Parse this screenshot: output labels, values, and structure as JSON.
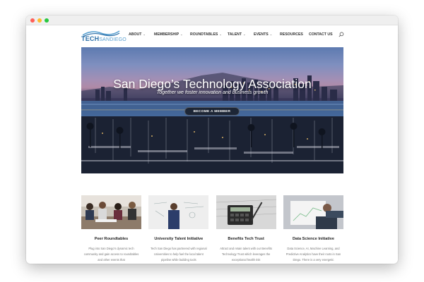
{
  "logo": {
    "bold": "TECH",
    "light": "SANDIEGO"
  },
  "nav": [
    {
      "label": "About",
      "dropdown": true,
      "width": 36
    },
    {
      "label": "Membership",
      "dropdown": true,
      "width": 51
    },
    {
      "label": "Roundtables",
      "dropdown": true,
      "width": 53
    },
    {
      "label": "Talent",
      "dropdown": true,
      "width": 37
    },
    {
      "label": "Events",
      "dropdown": true,
      "width": 37
    },
    {
      "label": "Resources",
      "dropdown": false,
      "width": 41
    },
    {
      "label": "Contact Us",
      "dropdown": false,
      "width": 40
    }
  ],
  "hero": {
    "title": "San Diego’s Technology Association",
    "subtitle": "Together we foster innovation and business growth",
    "button": "Become a Member"
  },
  "cards": [
    {
      "title": "Peer Roundtables",
      "text": "Plug into San Diego’s dynamic tech community and gain access to roundtables and other events that"
    },
    {
      "title": "University Talent Initiative",
      "text": "Tech San Diego has partnered with regional Universities to help fuel the local talent pipeline while building tools"
    },
    {
      "title": "Benefits Tech Trust",
      "text": "Attract and retain talent with our Benefits Technology Trust which leverages the exceptional health risk"
    },
    {
      "title": "Data Science Initiative",
      "text": "Data Science, AI, Machine Learning, and Predictive Analytics have their roots in San Diego. There is a very energetic"
    }
  ],
  "colors": {
    "accent": "#2a6fa8",
    "nav_text": "#333333",
    "button_bg": "#1d2636"
  },
  "icons": {
    "search": "search-icon",
    "dropdown": "chevron-down-icon"
  }
}
